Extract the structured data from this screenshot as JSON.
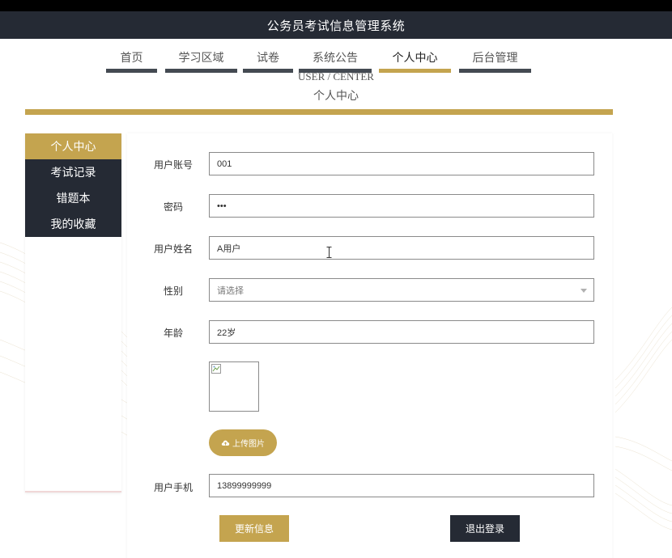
{
  "app": {
    "title": "公务员考试信息管理系统"
  },
  "nav": {
    "items": [
      {
        "label": "首页"
      },
      {
        "label": "学习区域"
      },
      {
        "label": "试卷"
      },
      {
        "label": "系统公告"
      },
      {
        "label": "个人中心",
        "active": true
      },
      {
        "label": "后台管理"
      }
    ]
  },
  "page": {
    "heading_en": "USER / CENTER",
    "heading_zh": "个人中心"
  },
  "sidebar": {
    "items": [
      {
        "label": "个人中心",
        "active": true
      },
      {
        "label": "考试记录"
      },
      {
        "label": "错题本"
      },
      {
        "label": "我的收藏"
      }
    ]
  },
  "form": {
    "account": {
      "label": "用户账号",
      "value": "001"
    },
    "password": {
      "label": "密码",
      "value": "•••"
    },
    "name": {
      "label": "用户姓名",
      "value": "A用户"
    },
    "gender": {
      "label": "性别",
      "placeholder": "请选择"
    },
    "age": {
      "label": "年龄",
      "value": "22岁"
    },
    "upload_label": "上传图片",
    "phone": {
      "label": "用户手机",
      "value": "13899999999"
    },
    "update_label": "更新信息",
    "logout_label": "退出登录"
  },
  "colors": {
    "accent": "#c4a44f",
    "dark": "#252a34"
  },
  "icons": {
    "upload": "cloud-upload-icon",
    "broken_image": "broken-image-icon",
    "dropdown": "chevron-down-icon"
  }
}
